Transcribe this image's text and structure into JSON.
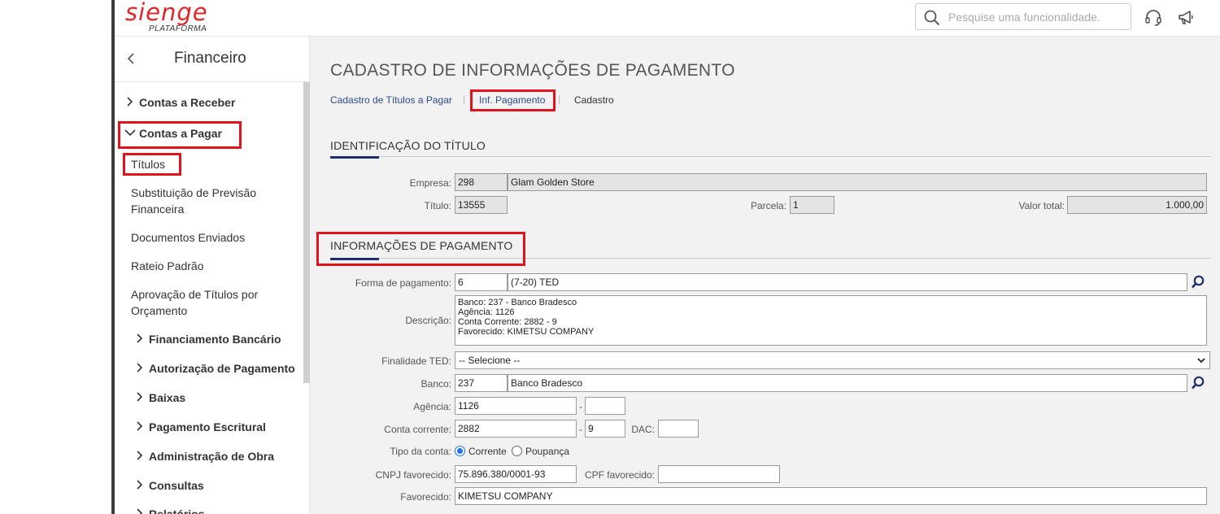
{
  "header": {
    "logo_main": "sienge",
    "logo_sub": "PLATAFORMA",
    "search_placeholder": "Pesquise uma funcionalidade."
  },
  "sidebar": {
    "title": "Financeiro",
    "items": [
      {
        "label": "Contas a Receber"
      },
      {
        "label": "Contas a Pagar"
      },
      {
        "label": "Títulos"
      },
      {
        "label": "Substituição de Previsão"
      },
      {
        "label": "Financeira"
      },
      {
        "label": "Documentos Enviados"
      },
      {
        "label": "Rateio Padrão"
      },
      {
        "label": "Aprovação de Títulos por"
      },
      {
        "label": "Orçamento"
      },
      {
        "label": "Financiamento Bancário"
      },
      {
        "label": "Autorização de Pagamento"
      },
      {
        "label": "Baixas"
      },
      {
        "label": "Pagamento Escritural"
      },
      {
        "label": "Administração de Obra"
      },
      {
        "label": "Consultas"
      },
      {
        "label": "Relatórios"
      }
    ]
  },
  "page": {
    "title": "CADASTRO DE INFORMAÇÕES DE PAGAMENTO",
    "breadcrumbs": [
      "Cadastro de Títulos a Pagar",
      "Inf. Pagamento",
      "Cadastro"
    ]
  },
  "identificacao": {
    "section_title": "IDENTIFICAÇÃO DO TÍTULO",
    "empresa_label": "Empresa:",
    "empresa_code": "298",
    "empresa_name": "Glam Golden Store",
    "titulo_label": "Título:",
    "titulo_value": "13555",
    "parcela_label": "Parcela:",
    "parcela_value": "1",
    "valor_label": "Valor total:",
    "valor_value": "1.000,00"
  },
  "pagamento": {
    "section_title": "INFORMAÇÕES DE PAGAMENTO",
    "forma_label": "Forma de pagamento:",
    "forma_code": "6",
    "forma_name": "(7-20) TED",
    "descricao_label": "Descrição:",
    "descricao_lines": [
      "Banco: 237 - Banco Bradesco",
      "Agência: 1126",
      "Conta Corrente: 2882 - 9",
      "Favorecido: KIMETSU COMPANY"
    ],
    "finalidade_label": "Finalidade TED:",
    "finalidade_value": "-- Selecione --",
    "banco_label": "Banco:",
    "banco_code": "237",
    "banco_name": "Banco Bradesco",
    "agencia_label": "Agência:",
    "agencia_value": "1126",
    "agencia_dv": "",
    "conta_label": "Conta corrente:",
    "conta_value": "2882",
    "conta_dv": "9",
    "dac_label": "DAC:",
    "dac_value": "",
    "tipo_label": "Tipo da conta:",
    "tipo_options": [
      "Corrente",
      "Poupança"
    ],
    "tipo_selected": "Corrente",
    "cnpj_label": "CNPJ favorecido:",
    "cnpj_value": "75.896.380/0001-93",
    "cpf_label": "CPF favorecido:",
    "cpf_value": "",
    "favorecido_label": "Favorecido:",
    "favorecido_value": "KIMETSU COMPANY"
  },
  "colors": {
    "brand": "#e0262b",
    "highlight": "#e0141e",
    "link": "#2b4a8a",
    "section_accent": "#1f2d6b",
    "radio": "#1a73e8"
  },
  "icons": [
    "search-icon",
    "headset-icon",
    "megaphone-icon",
    "chevron-left-icon",
    "chevron-right-icon",
    "chevron-down-icon",
    "magnifier-icon",
    "select-caret-icon"
  ]
}
